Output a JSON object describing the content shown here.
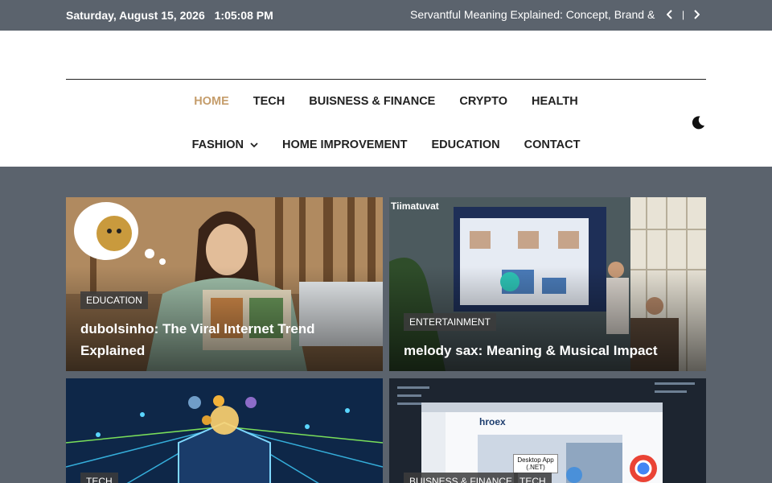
{
  "topbar": {
    "date": "Saturday, August 15, 2026",
    "time": "1:05:08 PM",
    "ticker_text": "Servantful Meaning Explained: Concept, Brand &",
    "separator": "|"
  },
  "nav": {
    "row1": [
      {
        "label": "HOME",
        "active": true
      },
      {
        "label": "TECH"
      },
      {
        "label": "BUISNESS & FINANCE"
      },
      {
        "label": "CRYPTO"
      },
      {
        "label": "HEALTH"
      }
    ],
    "row2": [
      {
        "label": "FASHION",
        "has_dropdown": true
      },
      {
        "label": "HOME IMPROVEMENT"
      },
      {
        "label": "EDUCATION"
      },
      {
        "label": "CONTACT"
      }
    ],
    "dark_mode_icon": "moon-icon"
  },
  "cards": [
    {
      "category": "EDUCATION",
      "title": "dubolsinho: The Viral Internet Trend Explained"
    },
    {
      "category": "ENTERTAINMENT",
      "title": "melody sax: Meaning & Musical Impact",
      "watermark": "Tiimatuvat"
    },
    {
      "category": "TECH",
      "title": ""
    },
    {
      "category": "BUISNESS & FINANCE",
      "category2": "TECH",
      "title": "",
      "overlay_text": "Desktop App (.NET)",
      "brand_text": "hroex"
    }
  ],
  "colors": {
    "accent": "#c59d6b",
    "topbar_bg": "#5b636d",
    "page_bg": "#5b636d"
  }
}
